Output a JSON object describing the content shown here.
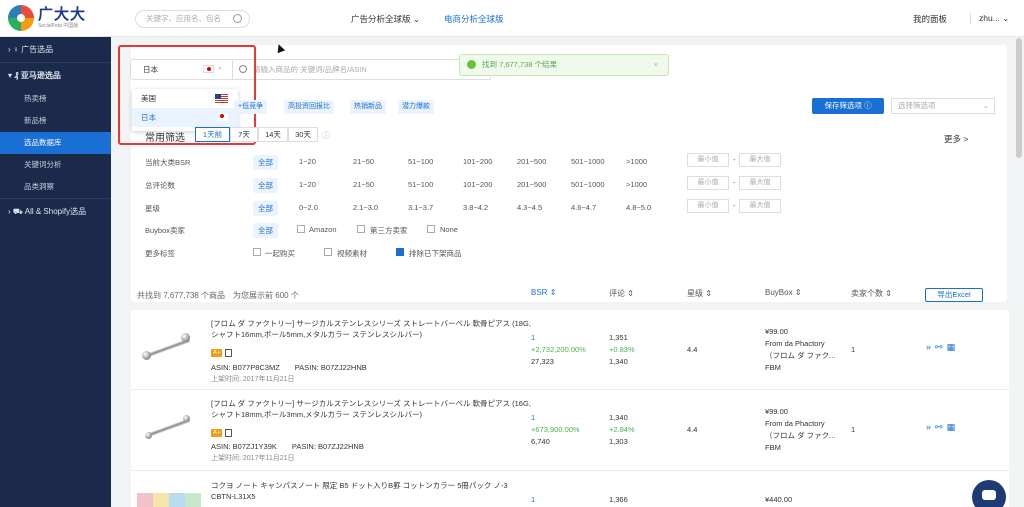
{
  "header": {
    "logo_main": "广大大",
    "logo_sub": "SocialPeta 中国版",
    "search_placeholder": "关键字、应用名、包名",
    "nav_ads": "广告分析全球版",
    "nav_ecom": "电商分析全球版",
    "my_panel": "我的面板",
    "user": "zhu..."
  },
  "sidebar": {
    "ads": "广告选品",
    "amazon": "亚马逊选品",
    "items": [
      "热卖榜",
      "新品榜",
      "选品数据库",
      "关键词分析",
      "品类洞察"
    ],
    "shopify": "All & Shopify选品"
  },
  "search": {
    "country": "日本",
    "keyword_placeholder": "请输入商品的 关键词/品牌名/ASIN",
    "countries": [
      "美国",
      "日本"
    ]
  },
  "toast": {
    "text": "找到 7,677,738 个结果"
  },
  "tags": [
    "+低竞争",
    "高投资回报比",
    "热销新品",
    "潜力爆款"
  ],
  "save_filter": "保存筛选项",
  "select_filter_placeholder": "选择筛选项",
  "common": {
    "label": "常用筛选",
    "timeframes": [
      "1天前",
      "7天",
      "14天",
      "30天"
    ],
    "more": "更多 >"
  },
  "filters": {
    "bsr": {
      "label": "当前大类BSR",
      "all": "全部",
      "opts": [
        "1~20",
        "21~50",
        "51~100",
        "101~200",
        "201~500",
        "501~1000",
        ">1000"
      ]
    },
    "reviews": {
      "label": "总评论数",
      "all": "全部",
      "opts": [
        "1~20",
        "21~50",
        "51~100",
        "101~200",
        "201~500",
        "501~1000",
        ">1000"
      ]
    },
    "stars": {
      "label": "星级",
      "all": "全部",
      "opts": [
        "0~2.0",
        "2.1~3.0",
        "3.1~3.7",
        "3.8~4.2",
        "4.3~4.5",
        "4.6~4.7",
        "4.8~5.0"
      ]
    },
    "buybox": {
      "label": "Buybox卖家",
      "all": "全部",
      "opts": [
        "Amazon",
        "第三方卖家",
        "None"
      ]
    },
    "more_tags": {
      "label": "更多标签",
      "opts": [
        "一起购买",
        "视频素材",
        "排除已下架商品"
      ]
    },
    "min": "最小值",
    "max": "最大值"
  },
  "summary": {
    "text": "共找到 7,677,738 个商品",
    "sub": "为您展示前 600 个"
  },
  "columns": {
    "bsr": "BSR",
    "reviews": "评论",
    "stars": "星级",
    "buybox": "BuyBox",
    "sellers": "卖家个数",
    "export": "导出Excel"
  },
  "products": [
    {
      "title": "[フロム ダ ファクトリー] サージカルステンレスシリーズ ストレートバーベル 軟骨ピアス (18G,シャフト16mm,ボール5mm,メタルカラー ステンレスシルバー)",
      "asin": "ASIN: B077P8C3MZ",
      "pasin": "PASIN: B07ZJ22HNB",
      "date": "上架时间: 2017年11月21日",
      "bsr": "1",
      "bsr_change": "+2,732,200.00%",
      "bsr_prev": "27,323",
      "rev": "1,351",
      "rev_change": "+0.83%",
      "rev_prev": "1,340",
      "stars": "4.4",
      "price": "¥99.00",
      "seller1": "From da Phactory",
      "seller2": "（フロム ダ ファク...",
      "fbm": "FBM",
      "sellers": "1"
    },
    {
      "title": "[フロム ダ ファクトリー] サージカルステンレスシリーズ ストレートバーベル 軟骨ピアス (16G,シャフト18mm,ボール3mm,メタルカラー ステンレスシルバー)",
      "asin": "ASIN: B07ZJ1Y39K",
      "pasin": "PASIN: B07ZJ22HNB",
      "date": "上架时间: 2017年11月21日",
      "bsr": "1",
      "bsr_change": "+673,900.00%",
      "bsr_prev": "6,740",
      "rev": "1,340",
      "rev_change": "+2.84%",
      "rev_prev": "1,303",
      "stars": "4.4",
      "price": "¥99.00",
      "seller1": "From da Phactory",
      "seller2": "（フロム ダ ファク...",
      "fbm": "FBM",
      "sellers": "1"
    },
    {
      "title": "コクヨ ノート キャンパスノート 限定 B5 ドット入りB罫 コットンカラー 5冊パック ノ-3",
      "title2": "CBTN-L31X5",
      "bsr": "1",
      "rev": "1,366",
      "price": "¥440.00"
    }
  ]
}
